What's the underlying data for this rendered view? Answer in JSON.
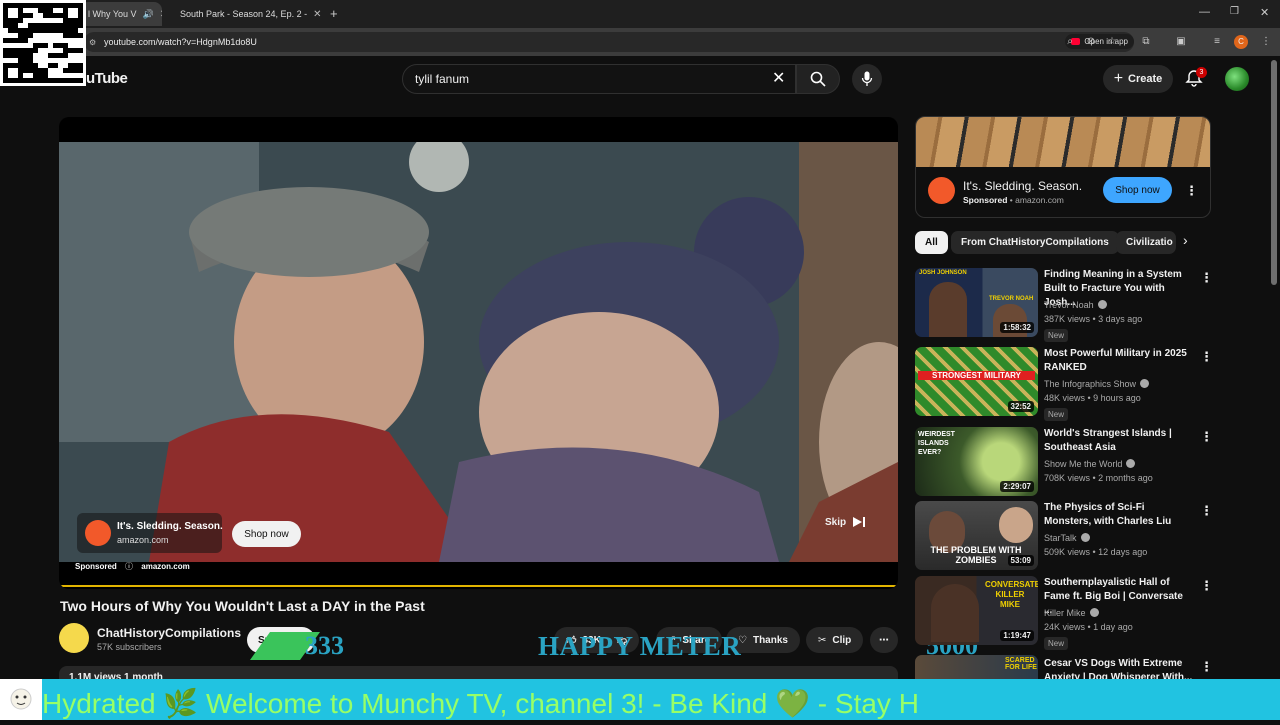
{
  "browser": {
    "tabs": [
      {
        "label": "l Why You V"
      },
      {
        "label": "South Park - Season 24, Ep. 2 -"
      }
    ],
    "url": "youtube.com/watch?v=HdgnMb1do8U",
    "open_in_app": "Open in app",
    "profile_initial": "C"
  },
  "header": {
    "logo": "uTube",
    "search_value": "tylil fanum",
    "create_label": "Create",
    "notification_count": "3"
  },
  "player": {
    "ad_title": "It's. Sledding. Season.",
    "ad_domain": "amazon.com",
    "shop_now": "Shop now",
    "skip": "Skip",
    "sponsored": "Sponsored",
    "sponsored_domain": "amazon.com"
  },
  "video": {
    "title": "Two Hours of Why You Wouldn't Last a DAY in the Past",
    "channel": "ChatHistoryCompilations",
    "subscribers": "57K subscribers",
    "subscribe": "Sub",
    "likes": "33K",
    "share": "Share",
    "thanks": "Thanks",
    "clip": "Clip",
    "description_start": "1.1M views  1 month"
  },
  "overlay": {
    "score_left": "333",
    "happy_meter": "HAPPY METER",
    "score_right": "5000",
    "ticker": "Hydrated 🌿          Welcome to Munchy TV, channel 3!  - Be Kind 💚 - Stay H"
  },
  "sidebar": {
    "ad": {
      "title": "It's. Sledding. Season.",
      "sponsored": "Sponsored",
      "domain": "amazon.com",
      "shop_now": "Shop now"
    },
    "chips": [
      "All",
      "From ChatHistoryCompilations",
      "Civilizatio"
    ],
    "recommendations": [
      {
        "title": "Finding Meaning in a System Built to Fracture You with Josh...",
        "channel": "Trevor Noah",
        "meta": "387K views • 3 days ago",
        "badge": "New",
        "duration": "1:58:32",
        "thumb_text": "JOSH JOHNSON",
        "thumb_text2": "TREVOR NOAH"
      },
      {
        "title": "Most Powerful Military in 2025 RANKED",
        "channel": "The Infographics Show",
        "meta": "48K views • 9 hours ago",
        "badge": "New",
        "duration": "32:52",
        "thumb_text": "STRONGEST MILITARY"
      },
      {
        "title": "World's Strangest Islands | Southeast Asia",
        "channel": "Show Me the World",
        "meta": "708K views • 2 months ago",
        "badge": "",
        "duration": "2:29:07",
        "thumb_text": "WEIRDEST ISLANDS EVER?"
      },
      {
        "title": "The Physics of Sci-Fi Monsters, with Charles Liu",
        "channel": "StarTalk",
        "meta": "509K views • 12 days ago",
        "badge": "",
        "duration": "53:09",
        "thumb_text": "THE PROBLEM WITH ZOMBIES"
      },
      {
        "title": "Southernplayalistic Hall of Fame ft. Big Boi | Conversate ...",
        "channel": "Killer Mike",
        "meta": "24K views • 1 day ago",
        "badge": "New",
        "duration": "1:19:47",
        "thumb_text": "CONVERSATE KILLER MIKE"
      },
      {
        "title": "Cesar VS Dogs With Extreme Anxiety | Dog Whisperer With...",
        "channel": "",
        "meta": "",
        "badge": "",
        "duration": "",
        "thumb_text": "SCARED FOR LIFE"
      }
    ]
  }
}
